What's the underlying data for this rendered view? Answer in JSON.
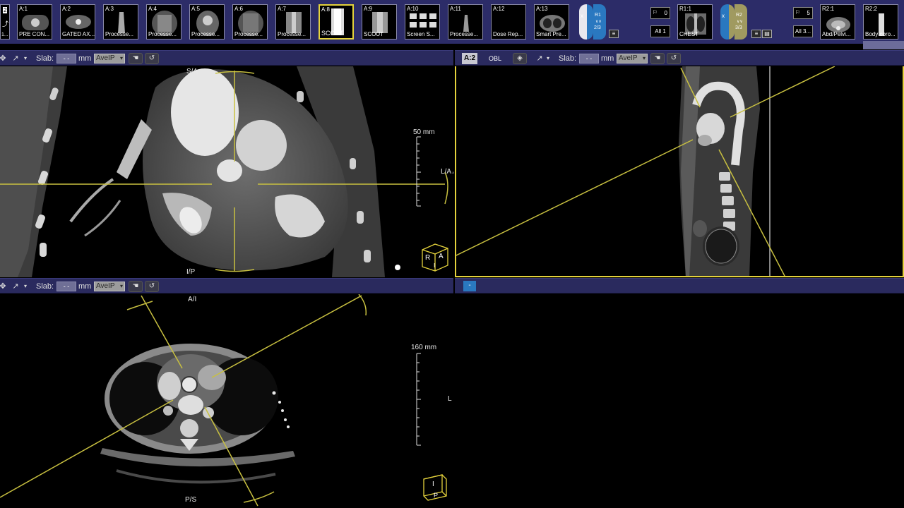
{
  "series_bar": {
    "left_stub": {
      "top": "2",
      "bottom": "1..."
    },
    "thumbnails_a": [
      {
        "id": "A:1",
        "label": "PRE CON..."
      },
      {
        "id": "A:2",
        "label": "GATED AX..."
      },
      {
        "id": "A:3",
        "label": "Processe..."
      },
      {
        "id": "A:4",
        "label": "Processe..."
      },
      {
        "id": "A:5",
        "label": "Processe..."
      },
      {
        "id": "A:6",
        "label": "Processe..."
      },
      {
        "id": "A:7",
        "label": "Processe..."
      },
      {
        "id": "A:8",
        "label": "SCOUT"
      },
      {
        "id": "A:9",
        "label": "SCOUT"
      },
      {
        "id": "A:10",
        "label": "Screen S..."
      },
      {
        "id": "A:11",
        "label": "Processe..."
      },
      {
        "id": "A:12",
        "label": "Dose Rep..."
      },
      {
        "id": "A:13",
        "label": "Smart Pre..."
      }
    ],
    "group_r1": {
      "x": "x",
      "name": "R1",
      "sub": "2/3",
      "count1": "0",
      "all": "All 1"
    },
    "thumbnail_r1": {
      "id": "R1:1",
      "label": "CHEST"
    },
    "group_r2": {
      "x": "x",
      "name": "R2",
      "sub": "3/3",
      "count1": "5",
      "all": "All 3..."
    },
    "thumbnails_r2": [
      {
        "id": "R2:1",
        "label": "Abd/Pelvi..."
      },
      {
        "id": "R2:2",
        "label": "Body coro..."
      }
    ]
  },
  "toolbar": {
    "slab_label": "Slab:",
    "slab_value": "- -",
    "unit": "mm",
    "mode": "AveIP",
    "badge": "A:2",
    "obl": "OBL",
    "collapsed_btn": "-"
  },
  "viewports": {
    "oblique": {
      "top_label": "S/A",
      "bottom_label": "I/P",
      "right_label": "L/A A/R",
      "scale": "50 mm",
      "cube": {
        "a": "A",
        "r": "R",
        "i": "I"
      }
    },
    "axial": {
      "top_label": "A/I",
      "bottom_label": "P/S",
      "right_label": "L",
      "scale": "160 mm",
      "cube": {
        "i": "I",
        "p": "P"
      }
    }
  },
  "colors": {
    "toolbar_bg": "#2a2a5e",
    "series_bar_bg": "#2c2c68",
    "active_yellow": "#e4d23c",
    "crosshair": "#c8c040",
    "r1_blue": "#2a78c0",
    "r2_tan": "#a09a60"
  }
}
